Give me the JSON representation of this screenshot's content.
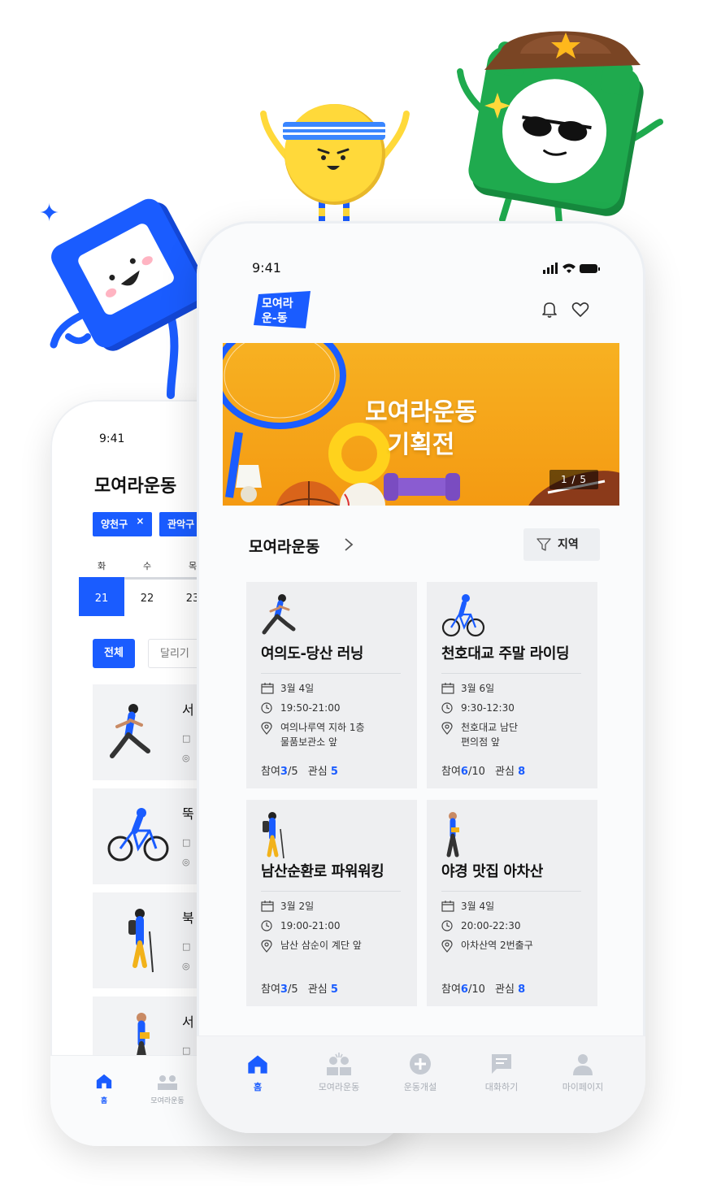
{
  "back_screen": {
    "status_time": "9:41",
    "title": "모여라운동",
    "region_chips": [
      {
        "label": "양천구",
        "remove": "×"
      },
      {
        "label": "관악구"
      }
    ],
    "week": {
      "day_names": [
        "화",
        "수",
        "목"
      ],
      "day_numbers": [
        "21",
        "22",
        "23"
      ],
      "selected_index": 0
    },
    "filters": [
      "전체",
      "달리기"
    ],
    "activity_titles": [
      "서",
      "뚝",
      "북",
      "서"
    ],
    "tabs": [
      {
        "label": "홈",
        "icon": "home-icon",
        "active": true
      },
      {
        "label": "모여라운동",
        "icon": "group-icon",
        "active": false
      }
    ]
  },
  "front_screen": {
    "status_time": "9:41",
    "logo_text": [
      "모여라",
      "운-동"
    ],
    "banner": {
      "title_line1": "모여라운동",
      "title_line2": "기획전",
      "counter": "1 / 5"
    },
    "section": {
      "title": "모여라운동",
      "region_button": "지역"
    },
    "cards": [
      {
        "title": "여의도-당산 러닝",
        "sport_icon": "runner-illustration",
        "date": "3월 4일",
        "time": "19:50-21:00",
        "place_line1": "여의나루역 지하 1층",
        "place_line2": "물품보관소 앞",
        "join_label": "참여",
        "joined": "3",
        "capacity": "/5",
        "interest_label": "관심",
        "interest": "5"
      },
      {
        "title": "천호대교 주말 라이딩",
        "sport_icon": "cyclist-illustration",
        "date": "3월 6일",
        "time": "9:30-12:30",
        "place_line1": "천호대교 남단",
        "place_line2": "편의점 앞",
        "join_label": "참여",
        "joined": "6",
        "capacity": "/10",
        "interest_label": "관심",
        "interest": "8"
      },
      {
        "title": "남산순환로 파워워킹",
        "sport_icon": "hiker-illustration",
        "date": "3월 2일",
        "time": "19:00-21:00",
        "place_line1": "남산 삼순이 계단 앞",
        "place_line2": "",
        "join_label": "참여",
        "joined": "3",
        "capacity": "/5",
        "interest_label": "관심",
        "interest": "5"
      },
      {
        "title": "야경 맛집 아차산",
        "sport_icon": "walker-illustration",
        "date": "3월 4일",
        "time": "20:00-22:30",
        "place_line1": "아차산역 2번출구",
        "place_line2": "",
        "join_label": "참여",
        "joined": "6",
        "capacity": "/10",
        "interest_label": "관심",
        "interest": "8"
      }
    ],
    "tabs": [
      {
        "label": "홈",
        "icon": "home-icon",
        "active": true
      },
      {
        "label": "모여라운동",
        "icon": "group-icon",
        "active": false
      },
      {
        "label": "운동개설",
        "icon": "plus-circle-icon",
        "active": false
      },
      {
        "label": "대화하기",
        "icon": "chat-icon",
        "active": false
      },
      {
        "label": "마이페이지",
        "icon": "person-icon",
        "active": false
      }
    ]
  },
  "colors": {
    "accent": "#1a5cff",
    "banner": "#f5a61a",
    "card_bg": "#eeeff1",
    "mascot_blue": "#1a5cff",
    "mascot_yellow": "#ffd93a",
    "mascot_green": "#1faa4e"
  }
}
